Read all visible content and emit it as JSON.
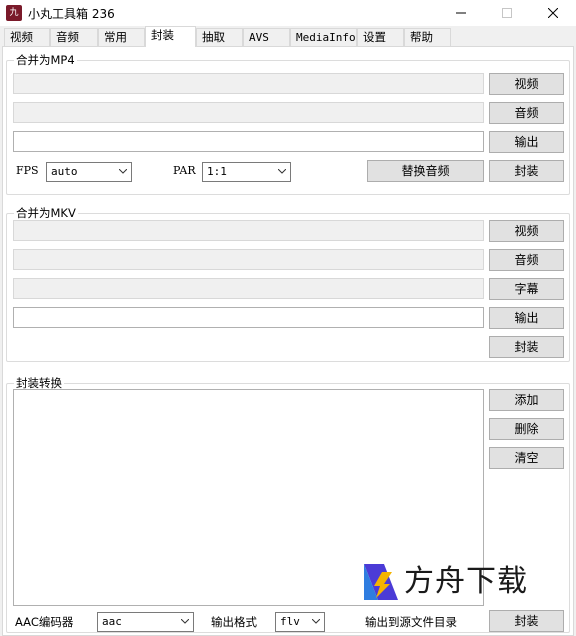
{
  "window": {
    "title": "小丸工具箱 236",
    "icon_text": "九"
  },
  "tabs": [
    {
      "label": "视频"
    },
    {
      "label": "音频"
    },
    {
      "label": "常用"
    },
    {
      "label": "封装"
    },
    {
      "label": "抽取"
    },
    {
      "label": "AVS"
    },
    {
      "label": "MediaInfo"
    },
    {
      "label": "设置"
    },
    {
      "label": "帮助"
    }
  ],
  "active_tab": "封装",
  "mp4": {
    "title": "合并为MP4",
    "video_button": "视频",
    "audio_button": "音频",
    "output_button": "输出",
    "fps_label": "FPS",
    "fps_value": "auto",
    "par_label": "PAR",
    "par_value": "1:1",
    "replace_audio_button": "替换音频",
    "mux_button": "封装"
  },
  "mkv": {
    "title": "合并为MKV",
    "video_button": "视频",
    "audio_button": "音频",
    "subtitle_button": "字幕",
    "output_button": "输出",
    "mux_button": "封装"
  },
  "convert": {
    "title": "封装转换",
    "add_button": "添加",
    "delete_button": "删除",
    "clear_button": "清空",
    "aac_label": "AAC编码器",
    "aac_value": "aac",
    "format_label": "输出格式",
    "format_value": "flv",
    "output_dir_label": "输出到源文件目录",
    "mux_button": "封装"
  },
  "watermark": {
    "text": "方舟下载"
  }
}
